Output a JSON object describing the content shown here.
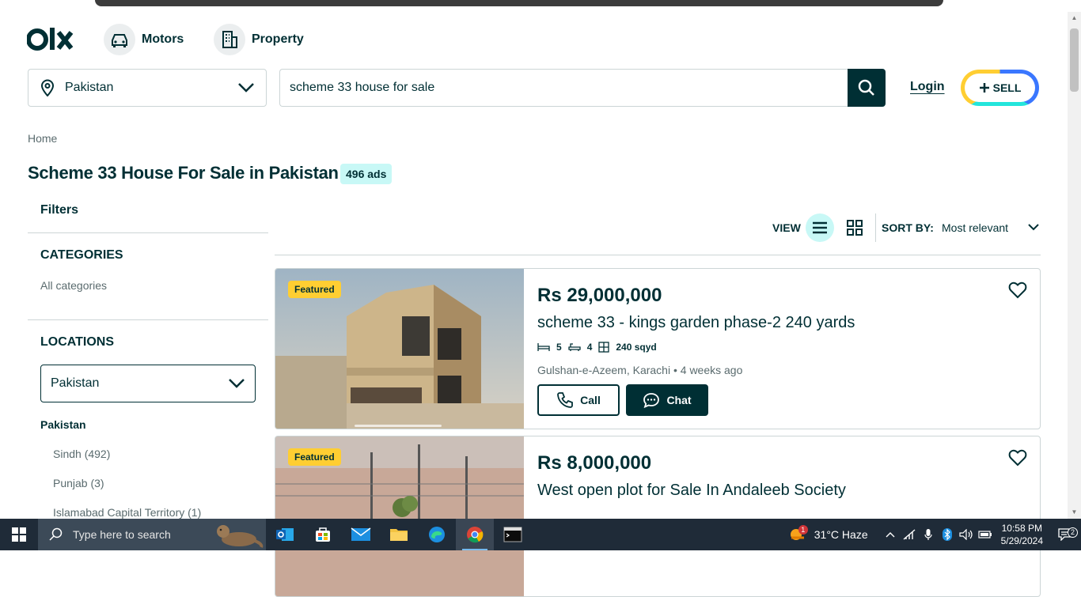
{
  "header": {
    "categories": [
      {
        "label": "Motors",
        "icon": "car-icon"
      },
      {
        "label": "Property",
        "icon": "building-icon"
      }
    ],
    "location": "Pakistan",
    "search_value": "scheme 33 house for sale",
    "login_label": "Login",
    "sell_label": "SELL"
  },
  "breadcrumb": "Home",
  "page_title": "Scheme 33 House For Sale in Pakistan",
  "ads_count": "496 ads",
  "filters": {
    "title": "Filters",
    "categories_heading": "CATEGORIES",
    "all_categories": "All categories",
    "locations_heading": "LOCATIONS",
    "location_selected": "Pakistan",
    "location_parent": "Pakistan",
    "location_children": [
      "Sindh (492)",
      "Punjab (3)",
      "Islamabad Capital Territory (1)"
    ]
  },
  "toolbar": {
    "view_label": "VIEW",
    "sort_label": "SORT BY:",
    "sort_value": "Most relevant"
  },
  "listings": [
    {
      "badge": "Featured",
      "price": "Rs 29,000,000",
      "title": "scheme 33 - kings garden phase-2 240 yards",
      "beds": "5",
      "baths": "4",
      "area": "240 sqyd",
      "location": "Gulshan-e-Azeem, Karachi",
      "time": "4 weeks ago",
      "call_label": "Call",
      "chat_label": "Chat"
    },
    {
      "badge": "Featured",
      "price": "Rs 8,000,000",
      "title": "West open plot for Sale In Andaleeb Society"
    }
  ],
  "taskbar": {
    "search_placeholder": "Type here to search",
    "weather": "31°C  Haze",
    "weather_badge": "1",
    "time": "10:58 PM",
    "date": "5/29/2024",
    "notification_count": "2"
  },
  "colors": {
    "primary": "#002f34",
    "badge_bg": "#c8f8f6",
    "featured": "#ffce32",
    "sell_blue": "#3a77ff",
    "sell_teal": "#23e5db",
    "sell_yellow": "#ffce32"
  }
}
